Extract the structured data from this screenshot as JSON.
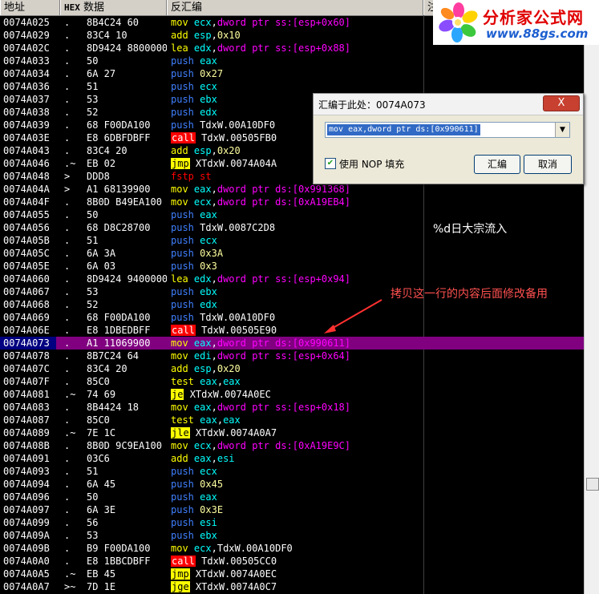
{
  "header": {
    "col_address": "地址",
    "col_hex_prefix": "HEX",
    "col_hex_suffix": " 数据",
    "col_disasm": "反汇编",
    "col_comment": "注"
  },
  "watermark": {
    "site_name": "分析家公式网",
    "site_url": "www.88gs.com"
  },
  "comment_text": "%d日大宗流入",
  "annotation": "拷贝这一行的内容后面修改备用",
  "dialog": {
    "title": "汇编于此处：0074A073",
    "close_label": "X",
    "input_value": "mov eax,dword ptr ds:[0x990611]",
    "checkbox_label": "使用 NOP 填充",
    "checkbox_checked": true,
    "assemble_label": "汇编",
    "cancel_label": "取消"
  },
  "colors": {
    "selected_row": "#800080",
    "mov": "#ffff00",
    "push": "#4080ff",
    "call_bg": "#ff0000",
    "jmp_bg": "#ffff00",
    "register": "#00ffff",
    "memory": "#ff00ff"
  },
  "selected_index": 25,
  "rows": [
    {
      "addr": "0074A025",
      "mark": ".",
      "hex": "8B4C24 60",
      "mn": "mov",
      "ops": [
        [
          "r",
          "ecx"
        ],
        [
          "s",
          ","
        ],
        [
          "m",
          "dword ptr ss:[esp+0x60]"
        ]
      ]
    },
    {
      "addr": "0074A029",
      "mark": ".",
      "hex": "83C4 10",
      "mn": "add",
      "ops": [
        [
          "r",
          "esp"
        ],
        [
          "s",
          ","
        ],
        [
          "n",
          "0x10"
        ]
      ]
    },
    {
      "addr": "0074A02C",
      "mark": ".",
      "hex": "8D9424 88000000",
      "mn": "lea",
      "ops": [
        [
          "r",
          "edx"
        ],
        [
          "s",
          ","
        ],
        [
          "m",
          "dword ptr ss:[esp+0x88]"
        ]
      ]
    },
    {
      "addr": "0074A033",
      "mark": ".",
      "hex": "50",
      "mn": "push",
      "ops": [
        [
          "r",
          "eax"
        ]
      ]
    },
    {
      "addr": "0074A034",
      "mark": ".",
      "hex": "6A 27",
      "mn": "push",
      "ops": [
        [
          "n",
          "0x27"
        ]
      ]
    },
    {
      "addr": "0074A036",
      "mark": ".",
      "hex": "51",
      "mn": "push",
      "ops": [
        [
          "r",
          "ecx"
        ]
      ]
    },
    {
      "addr": "0074A037",
      "mark": ".",
      "hex": "53",
      "mn": "push",
      "ops": [
        [
          "r",
          "ebx"
        ]
      ]
    },
    {
      "addr": "0074A038",
      "mark": ".",
      "hex": "52",
      "mn": "push",
      "ops": [
        [
          "r",
          "edx"
        ]
      ]
    },
    {
      "addr": "0074A039",
      "mark": ".",
      "hex": "68 F00DA100",
      "mn": "push",
      "ops": [
        [
          "p",
          "TdxW.00A10DF0"
        ]
      ]
    },
    {
      "addr": "0074A03E",
      "mark": ".",
      "hex": "E8 6DBFDBFF",
      "mn": "call",
      "ops": [
        [
          "p",
          "TdxW.00505FB0"
        ]
      ]
    },
    {
      "addr": "0074A043",
      "mark": ".",
      "hex": "83C4 20",
      "mn": "add",
      "ops": [
        [
          "r",
          "esp"
        ],
        [
          "s",
          ","
        ],
        [
          "n",
          "0x20"
        ]
      ]
    },
    {
      "addr": "0074A046",
      "mark": ".~",
      "hex": "EB 02",
      "mn": "jmp",
      "ops": [
        [
          "p",
          "XTdxW.0074A04A"
        ]
      ]
    },
    {
      "addr": "0074A048",
      "mark": ">",
      "hex": "DDD8",
      "mn": "fstp",
      "ops": [
        [
          "f",
          "st"
        ]
      ]
    },
    {
      "addr": "0074A04A",
      "mark": ">",
      "hex": "A1 68139900",
      "mn": "mov",
      "ops": [
        [
          "r",
          "eax"
        ],
        [
          "s",
          ","
        ],
        [
          "m",
          "dword ptr ds:[0x991368]"
        ]
      ]
    },
    {
      "addr": "0074A04F",
      "mark": ".",
      "hex": "8B0D B49EA100",
      "mn": "mov",
      "ops": [
        [
          "r",
          "ecx"
        ],
        [
          "s",
          ","
        ],
        [
          "m",
          "dword ptr ds:[0xA19EB4]"
        ]
      ]
    },
    {
      "addr": "0074A055",
      "mark": ".",
      "hex": "50",
      "mn": "push",
      "ops": [
        [
          "r",
          "eax"
        ]
      ]
    },
    {
      "addr": "0074A056",
      "mark": ".",
      "hex": "68 D8C28700",
      "mn": "push",
      "ops": [
        [
          "p",
          "TdxW.0087C2D8"
        ]
      ]
    },
    {
      "addr": "0074A05B",
      "mark": ".",
      "hex": "51",
      "mn": "push",
      "ops": [
        [
          "r",
          "ecx"
        ]
      ]
    },
    {
      "addr": "0074A05C",
      "mark": ".",
      "hex": "6A 3A",
      "mn": "push",
      "ops": [
        [
          "n",
          "0x3A"
        ]
      ]
    },
    {
      "addr": "0074A05E",
      "mark": ".",
      "hex": "6A 03",
      "mn": "push",
      "ops": [
        [
          "n",
          "0x3"
        ]
      ]
    },
    {
      "addr": "0074A060",
      "mark": ".",
      "hex": "8D9424 94000000",
      "mn": "lea",
      "ops": [
        [
          "r",
          "edx"
        ],
        [
          "s",
          ","
        ],
        [
          "m",
          "dword ptr ss:[esp+0x94]"
        ]
      ]
    },
    {
      "addr": "0074A067",
      "mark": ".",
      "hex": "53",
      "mn": "push",
      "ops": [
        [
          "r",
          "ebx"
        ]
      ]
    },
    {
      "addr": "0074A068",
      "mark": ".",
      "hex": "52",
      "mn": "push",
      "ops": [
        [
          "r",
          "edx"
        ]
      ]
    },
    {
      "addr": "0074A069",
      "mark": ".",
      "hex": "68 F00DA100",
      "mn": "push",
      "ops": [
        [
          "p",
          "TdxW.00A10DF0"
        ]
      ]
    },
    {
      "addr": "0074A06E",
      "mark": ".",
      "hex": "E8 1DBEDBFF",
      "mn": "call",
      "ops": [
        [
          "p",
          "TdxW.00505E90"
        ]
      ]
    },
    {
      "addr": "0074A073",
      "mark": ".",
      "hex": "A1 11069900",
      "mn": "mov",
      "ops": [
        [
          "r",
          "eax"
        ],
        [
          "s",
          ","
        ],
        [
          "m",
          "dword ptr ds:[0x990611]"
        ]
      ]
    },
    {
      "addr": "0074A078",
      "mark": ".",
      "hex": "8B7C24 64",
      "mn": "mov",
      "ops": [
        [
          "r",
          "edi"
        ],
        [
          "s",
          ","
        ],
        [
          "m",
          "dword ptr ss:[esp+0x64]"
        ]
      ]
    },
    {
      "addr": "0074A07C",
      "mark": ".",
      "hex": "83C4 20",
      "mn": "add",
      "ops": [
        [
          "r",
          "esp"
        ],
        [
          "s",
          ","
        ],
        [
          "n",
          "0x20"
        ]
      ]
    },
    {
      "addr": "0074A07F",
      "mark": ".",
      "hex": "85C0",
      "mn": "test",
      "ops": [
        [
          "r",
          "eax"
        ],
        [
          "s",
          ","
        ],
        [
          "r",
          "eax"
        ]
      ]
    },
    {
      "addr": "0074A081",
      "mark": ".~",
      "hex": "74 69",
      "mn": "je",
      "ops": [
        [
          "p",
          "XTdxW.0074A0EC"
        ]
      ]
    },
    {
      "addr": "0074A083",
      "mark": ".",
      "hex": "8B4424 18",
      "mn": "mov",
      "ops": [
        [
          "r",
          "eax"
        ],
        [
          "s",
          ","
        ],
        [
          "m",
          "dword ptr ss:[esp+0x18]"
        ]
      ]
    },
    {
      "addr": "0074A087",
      "mark": ".",
      "hex": "85C0",
      "mn": "test",
      "ops": [
        [
          "r",
          "eax"
        ],
        [
          "s",
          ","
        ],
        [
          "r",
          "eax"
        ]
      ]
    },
    {
      "addr": "0074A089",
      "mark": ".~",
      "hex": "7E 1C",
      "mn": "jle",
      "ops": [
        [
          "p",
          "XTdxW.0074A0A7"
        ]
      ]
    },
    {
      "addr": "0074A08B",
      "mark": ".",
      "hex": "8B0D 9C9EA100",
      "mn": "mov",
      "ops": [
        [
          "r",
          "ecx"
        ],
        [
          "s",
          ","
        ],
        [
          "m",
          "dword ptr ds:[0xA19E9C]"
        ]
      ]
    },
    {
      "addr": "0074A091",
      "mark": ".",
      "hex": "03C6",
      "mn": "add",
      "ops": [
        [
          "r",
          "eax"
        ],
        [
          "s",
          ","
        ],
        [
          "r",
          "esi"
        ]
      ]
    },
    {
      "addr": "0074A093",
      "mark": ".",
      "hex": "51",
      "mn": "push",
      "ops": [
        [
          "r",
          "ecx"
        ]
      ]
    },
    {
      "addr": "0074A094",
      "mark": ".",
      "hex": "6A 45",
      "mn": "push",
      "ops": [
        [
          "n",
          "0x45"
        ]
      ]
    },
    {
      "addr": "0074A096",
      "mark": ".",
      "hex": "50",
      "mn": "push",
      "ops": [
        [
          "r",
          "eax"
        ]
      ]
    },
    {
      "addr": "0074A097",
      "mark": ".",
      "hex": "6A 3E",
      "mn": "push",
      "ops": [
        [
          "n",
          "0x3E"
        ]
      ]
    },
    {
      "addr": "0074A099",
      "mark": ".",
      "hex": "56",
      "mn": "push",
      "ops": [
        [
          "r",
          "esi"
        ]
      ]
    },
    {
      "addr": "0074A09A",
      "mark": ".",
      "hex": "53",
      "mn": "push",
      "ops": [
        [
          "r",
          "ebx"
        ]
      ]
    },
    {
      "addr": "0074A09B",
      "mark": ".",
      "hex": "B9 F00DA100",
      "mn": "mov",
      "ops": [
        [
          "r",
          "ecx"
        ],
        [
          "s",
          ","
        ],
        [
          "p",
          "TdxW.00A10DF0"
        ]
      ]
    },
    {
      "addr": "0074A0A0",
      "mark": ".",
      "hex": "E8 1BBCDBFF",
      "mn": "call",
      "ops": [
        [
          "p",
          "TdxW.00505CC0"
        ]
      ]
    },
    {
      "addr": "0074A0A5",
      "mark": ".~",
      "hex": "EB 45",
      "mn": "jmp",
      "ops": [
        [
          "p",
          "XTdxW.0074A0EC"
        ]
      ]
    },
    {
      "addr": "0074A0A7",
      "mark": ">~",
      "hex": "7D 1E",
      "mn": "jge",
      "ops": [
        [
          "p",
          "XTdxW.0074A0C7"
        ]
      ]
    }
  ]
}
